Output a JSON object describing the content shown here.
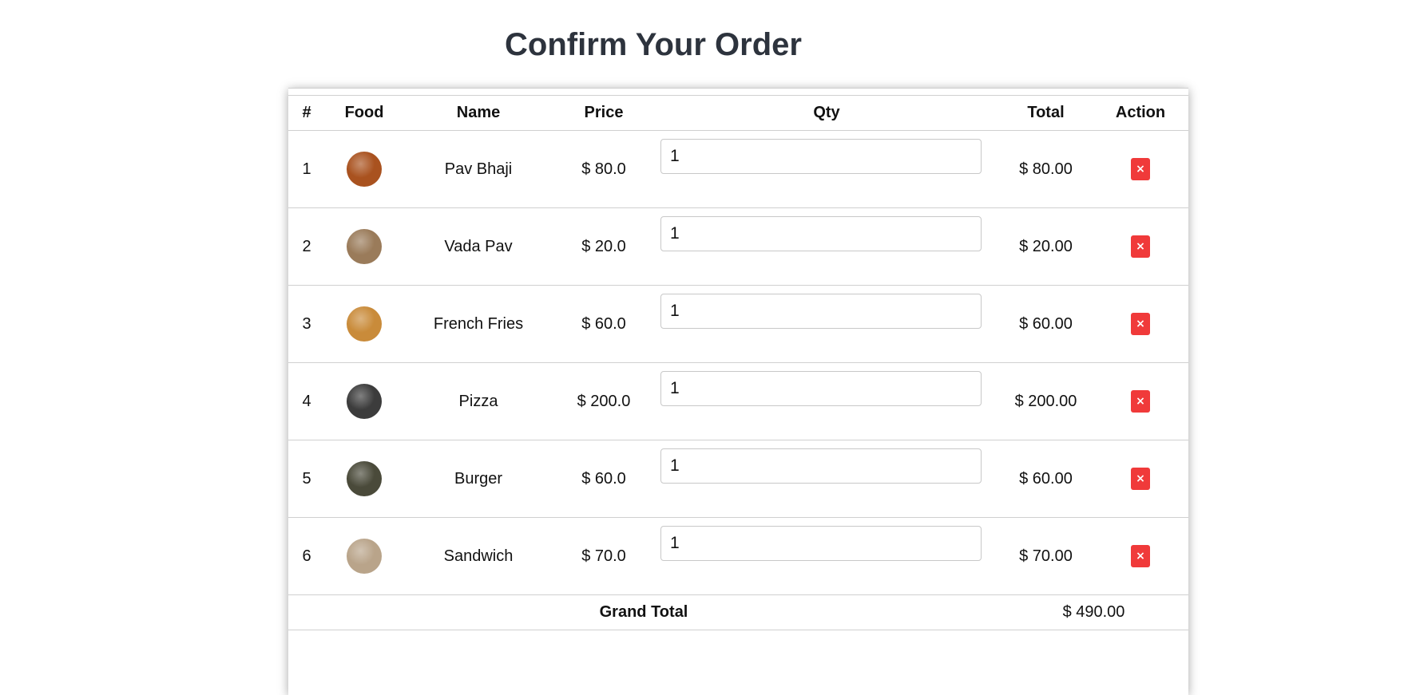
{
  "page": {
    "title": "Confirm Your Order"
  },
  "table": {
    "headers": [
      "#",
      "Food",
      "Name",
      "Price",
      "Qty",
      "Total",
      "Action"
    ],
    "rows": [
      {
        "index": "1",
        "food_image": "pav-bhaji-image",
        "name": "Pav Bhaji",
        "price": "$ 80.0",
        "qty": "1",
        "total": "$ 80.00",
        "action_icon": "close-icon",
        "action_label": "×",
        "img_color": "#a9521f"
      },
      {
        "index": "2",
        "food_image": "vada-pav-image",
        "name": "Vada Pav",
        "price": "$ 20.0",
        "qty": "1",
        "total": "$ 20.00",
        "action_icon": "close-icon",
        "action_label": "×",
        "img_color": "#9a7b5a"
      },
      {
        "index": "3",
        "food_image": "french-fries-image",
        "name": "French Fries",
        "price": "$ 60.0",
        "qty": "1",
        "total": "$ 60.00",
        "action_icon": "close-icon",
        "action_label": "×",
        "img_color": "#c98b3a"
      },
      {
        "index": "4",
        "food_image": "pizza-image",
        "name": "Pizza",
        "price": "$ 200.0",
        "qty": "1",
        "total": "$ 200.00",
        "action_icon": "close-icon",
        "action_label": "×",
        "img_color": "#3c3c3c"
      },
      {
        "index": "5",
        "food_image": "burger-image",
        "name": "Burger",
        "price": "$ 60.0",
        "qty": "1",
        "total": "$ 60.00",
        "action_icon": "close-icon",
        "action_label": "×",
        "img_color": "#4a4a3a"
      },
      {
        "index": "6",
        "food_image": "sandwich-image",
        "name": "Sandwich",
        "price": "$ 70.0",
        "qty": "1",
        "total": "$ 70.00",
        "action_icon": "close-icon",
        "action_label": "×",
        "img_color": "#b9a48a"
      }
    ],
    "grand_total_label": "Grand Total",
    "grand_total_value": "$ 490.00"
  },
  "colors": {
    "title": "#2d333d",
    "remove_button": "#f03a3a",
    "border": "#d0d0d0"
  }
}
